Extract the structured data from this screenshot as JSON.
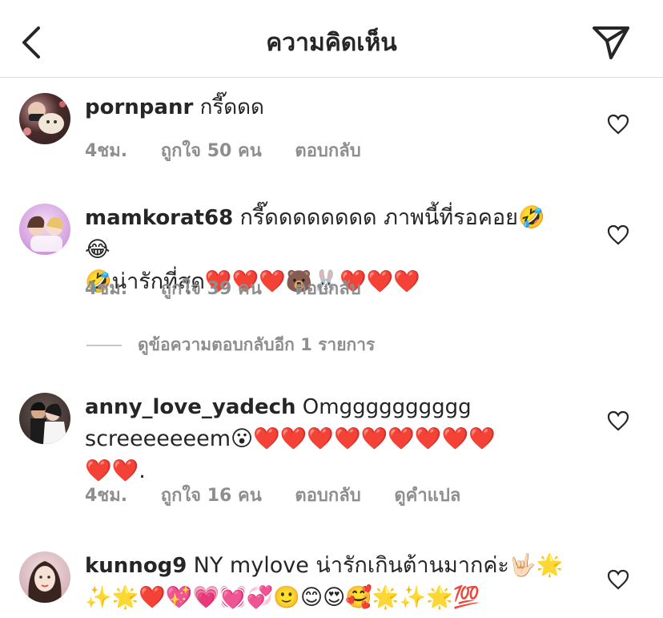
{
  "header": {
    "title": "ความคิดเห็น"
  },
  "comments": [
    {
      "username": "pornpanr",
      "text": "กรี๊ดดด",
      "line2": "",
      "line3": "",
      "time": "4ชม.",
      "likes": "ถูกใจ 50 คน",
      "reply": "ตอบกลับ",
      "translate": ""
    },
    {
      "username": "mamkorat68",
      "text": "กรี๊ดดดดดดดด ภาพนี้ที่รอคอย🤣😂",
      "line2": "🤣น่ารักที่สุด❤️❤️❤️🐻🐰❤️❤️❤️",
      "line3": "",
      "time": "4ชม.",
      "likes": "ถูกใจ 39 คน",
      "reply": "ตอบกลับ",
      "translate": ""
    },
    {
      "username": "anny_love_yadech",
      "text": "Omgggggggggg",
      "line2": "screeeeeeem😮❤️❤️❤️❤️❤️❤️❤️❤️❤️",
      "line3": "❤️❤️.",
      "time": "4ชม.",
      "likes": "ถูกใจ 16 คน",
      "reply": "ตอบกลับ",
      "translate": "ดูคำแปล"
    },
    {
      "username": "kunnog9",
      "text": "NY mylove น่ารักเกินต้านมากค่ะ🤟🏻🌟",
      "line2": "✨🌟❤️💖💗💓💞🙂😊😍🥰🌟✨🌟💯",
      "line3": "",
      "time": "",
      "likes": "",
      "reply": "",
      "translate": ""
    }
  ],
  "view_replies": "ดูข้อความตอบกลับอีก 1 รายการ",
  "icons": {
    "back": "chevron-left-icon",
    "send": "paper-plane-icon",
    "like": "heart-outline-icon"
  }
}
